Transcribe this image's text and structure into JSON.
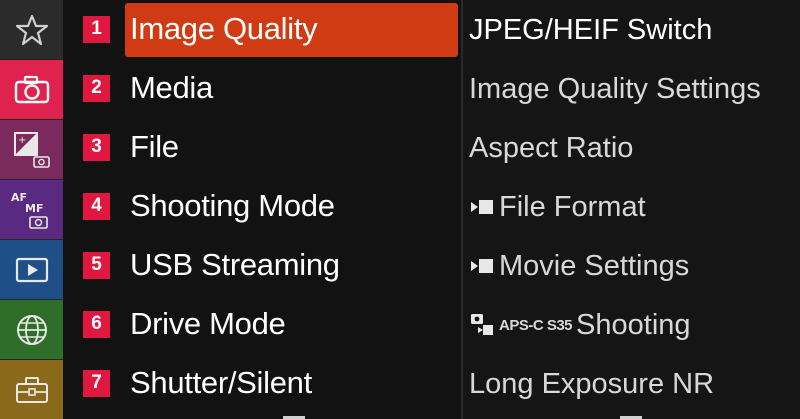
{
  "sidebar": {
    "tabs": [
      {
        "icon": "star-icon"
      },
      {
        "icon": "camera-icon"
      },
      {
        "icon": "exposure-camera-icon"
      },
      {
        "icon": "af-mf-camera-icon",
        "label": "AF MF"
      },
      {
        "icon": "playback-icon"
      },
      {
        "icon": "globe-icon"
      },
      {
        "icon": "toolbox-icon"
      }
    ],
    "colors": {
      "camera_active": "#e0234e",
      "exposure": "#7a2a5c",
      "focus": "#5a2a80",
      "playback": "#1e4f86",
      "network": "#2f6e2a",
      "setup": "#8a6a1a"
    }
  },
  "menu": {
    "selected_index": 0,
    "selected_color": "#d13b13",
    "number_badge_color": "#e0173f",
    "items": [
      {
        "number": "1",
        "label": "Image Quality"
      },
      {
        "number": "2",
        "label": "Media"
      },
      {
        "number": "3",
        "label": "File"
      },
      {
        "number": "4",
        "label": "Shooting Mode"
      },
      {
        "number": "5",
        "label": "USB Streaming"
      },
      {
        "number": "6",
        "label": "Drive Mode"
      },
      {
        "number": "7",
        "label": "Shutter/Silent"
      }
    ]
  },
  "submenu": {
    "items": [
      {
        "label": "JPEG/HEIF Switch"
      },
      {
        "label": "Image Quality Settings"
      },
      {
        "label": "Aspect Ratio"
      },
      {
        "label": "File Format",
        "icon": "movie-icon"
      },
      {
        "label": "Movie Settings",
        "icon": "movie-icon"
      },
      {
        "label": "Shooting",
        "icon": "still-movie-icon",
        "tag": "APS-C S35"
      },
      {
        "label": "Long Exposure NR"
      }
    ]
  }
}
